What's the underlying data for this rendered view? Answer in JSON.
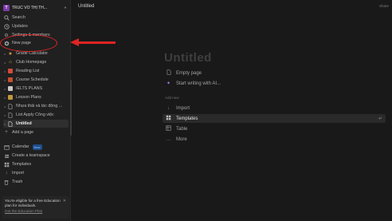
{
  "workspace": {
    "initial": "T",
    "name": "TRÚC VÕ THỊ TH..."
  },
  "sidebar": {
    "top_items": [
      {
        "label": "Search",
        "icon": "search-icon"
      },
      {
        "label": "Updates",
        "icon": "clock-icon"
      },
      {
        "label": "Settings & members",
        "icon": "gear-icon"
      },
      {
        "label": "New page",
        "icon": "plus-circle-icon"
      }
    ],
    "pages": [
      {
        "label": "Grade Calculator",
        "icon": "star-icon",
        "color": "#e8a13a"
      },
      {
        "label": "Club Homepage",
        "icon": "home-icon",
        "color": "#d9b13b"
      },
      {
        "label": "Reading List",
        "icon": "book-icon",
        "color": "#d24b3b"
      },
      {
        "label": "Course Schedule",
        "icon": "calendar-icon",
        "color": "#c7502f"
      },
      {
        "label": "IELTS PLANS",
        "icon": "page-icon",
        "color": "#c9c9c9"
      },
      {
        "label": "Lesson Plans",
        "icon": "notebook-icon",
        "color": "#c2973c"
      },
      {
        "label": "Nhựa thải và tác động ...",
        "icon": "page-icon",
        "color": "#9b9b9b"
      },
      {
        "label": "List Apply Công việc",
        "icon": "page-icon",
        "color": "#9b9b9b"
      },
      {
        "label": "Untitled",
        "icon": "page-icon",
        "color": "#cfcfcf"
      }
    ],
    "add_page": "Add a page",
    "bottom_items": [
      {
        "label": "Calendar",
        "icon": "calendar-icon",
        "badge": "New"
      },
      {
        "label": "Create a teamspace",
        "icon": "teamspace-icon"
      },
      {
        "label": "Templates",
        "icon": "templates-icon"
      },
      {
        "label": "Import",
        "icon": "import-icon"
      },
      {
        "label": "Trash",
        "icon": "trash-icon"
      }
    ],
    "promo": {
      "text": "You're eligible for a free Education plan for individuals.",
      "link": "Get the Education Plan"
    }
  },
  "topbar": {
    "title": "Untitled",
    "share": "Share"
  },
  "editor": {
    "placeholder_title": "Untitled",
    "options": [
      {
        "label": "Empty page",
        "icon": "page-icon"
      },
      {
        "label": "Start writing with AI...",
        "icon": "ai-sparkle-icon"
      }
    ],
    "add_new_label": "Add new",
    "add_new_items": [
      {
        "label": "Import",
        "icon": "import-icon"
      },
      {
        "label": "Templates",
        "icon": "templates-icon"
      },
      {
        "label": "Table",
        "icon": "table-icon"
      },
      {
        "label": "More",
        "icon": "more-icon"
      }
    ]
  },
  "annotation": {
    "color": "#e02424"
  }
}
